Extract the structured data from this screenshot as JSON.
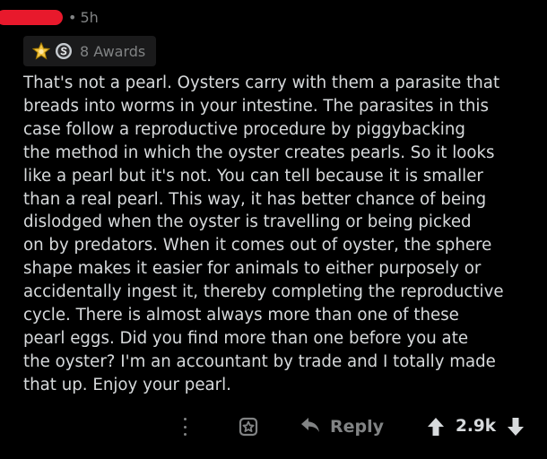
{
  "comment": {
    "age": "5h",
    "awards_label": "8 Awards",
    "award_icons": [
      "gold-star-award-icon",
      "silver-coin-award-icon"
    ],
    "body_lines": [
      "That's not a pearl.  Oysters carry with them a parasite that",
      "breads into worms in your intestine.  The parasites in this",
      "case follow a reproductive procedure by piggybacking",
      "the method in which the oyster creates pearls.  So it looks",
      "like a pearl but it's not.  You can tell because it is smaller",
      "than a real pearl.  This way, it has better chance of being",
      "dislodged when the oyster is travelling or being picked",
      "on by predators.  When it comes out of oyster, the sphere",
      "shape makes it easier for animals to either purposely or",
      "accidentally ingest it, thereby completing the reproductive",
      "cycle.  There is almost always more than one of these",
      "pearl eggs.  Did you find more than one before you ate",
      "the oyster?  I'm an accountant by trade and I totally made",
      "that up. Enjoy your pearl."
    ]
  },
  "actions": {
    "more_icon": "more-options-icon",
    "award_icon": "award-icon",
    "reply_icon": "reply-arrow-icon",
    "reply_label": "Reply",
    "upvote_icon": "upvote-arrow-icon",
    "score": "2.9k",
    "downvote_icon": "downvote-arrow-icon"
  },
  "colors": {
    "background": "#000000",
    "text": "#d7dadc",
    "muted": "#818384",
    "redaction": "#e8192c",
    "award_chip": "#1a1a1b"
  }
}
